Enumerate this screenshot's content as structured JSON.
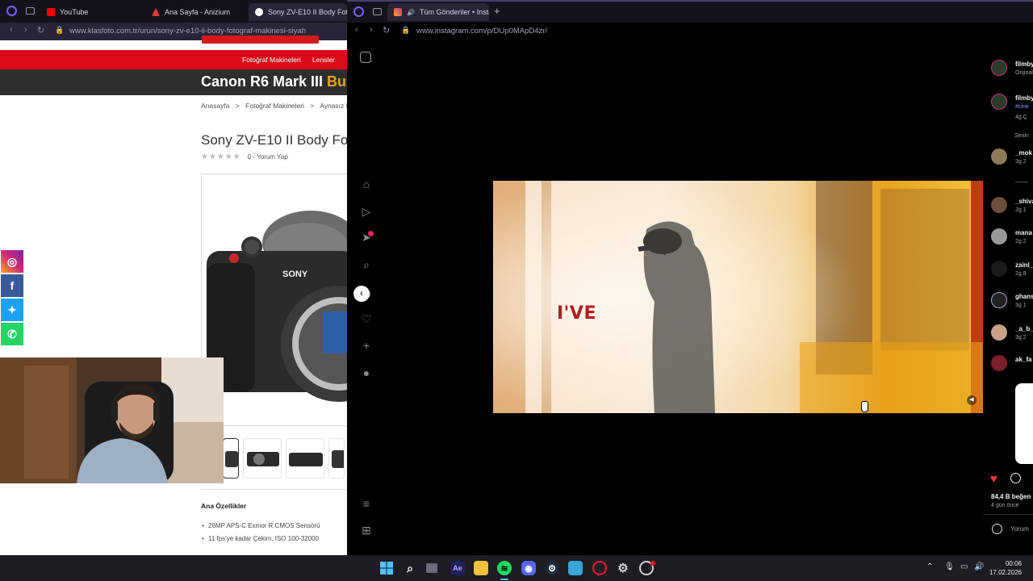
{
  "left_browser": {
    "tabs": [
      {
        "label": "YouTube",
        "favicon_color": "#ff0000"
      },
      {
        "label": "Ana Sayfa - Anizium",
        "favicon_color": "#e53935"
      },
      {
        "label": "Sony ZV-E10 II Body Fotoğ",
        "favicon_color": "#ffffff"
      }
    ],
    "url": "www.klasfoto.com.tr/urun/sony-zv-e10-ii-body-fotograf-makinesi-siyah"
  },
  "site": {
    "nav": [
      "Fotoğraf Makineleri",
      "Lensler"
    ],
    "banner_main": "Canon R6 Mark III",
    "banner_accent": "Bu",
    "breadcrumb": [
      "Anasayfa",
      ">",
      "Fotoğraf Makineleri",
      ">",
      "Aynasız Fo"
    ],
    "product_title": "Sony ZV-E10 II Body Fo",
    "rating_text": "0 - Yorum Yap",
    "rating_stars": "★★★★★",
    "camera_brand": "SONY",
    "features_title": "Ana Özellikler",
    "features": [
      "26MP APS-C Exmor R CMOS Sensörü",
      "11 fps'ye kadar Çekim, ISO 100-32000"
    ],
    "social": [
      {
        "name": "instagram",
        "glyph": "◎",
        "color": "#d62976"
      },
      {
        "name": "facebook",
        "glyph": "f",
        "color": "#3b5998"
      },
      {
        "name": "twitter",
        "glyph": "✦",
        "color": "#1da1f2"
      },
      {
        "name": "whatsapp",
        "glyph": "✆",
        "color": "#25d366"
      }
    ]
  },
  "right_browser": {
    "tab_label": "Tüm Gönderiler • Insta",
    "url": "www.instagram.com/p/DUp0MApD4zr/",
    "add_tab": "+"
  },
  "instagram": {
    "video_caption": "I'VE",
    "comments": [
      {
        "name": "filmby",
        "meta": "Orijinal",
        "color": "#4caf50"
      },
      {
        "name": "filmby",
        "meta": "#cine",
        "color": "#4caf50"
      },
      {
        "name": "",
        "meta": "4g  Ç",
        "color": ""
      },
      {
        "name": "Senin",
        "meta": "",
        "color": ""
      },
      {
        "name": "_mok",
        "meta": "3g  2",
        "color": "#8d7a5a"
      },
      {
        "name": "_shiva",
        "meta": "2g  1",
        "color": "#6b4e3a"
      },
      {
        "name": "mana",
        "meta": "2g  2",
        "color": "#999999"
      },
      {
        "name": "zainl_",
        "meta": "2g  8",
        "color": "#222222"
      },
      {
        "name": "ghans",
        "meta": "3g  1",
        "color": "#b8a0d8"
      },
      {
        "name": "_a_b_",
        "meta": "3g  2",
        "color": "#c9a08a"
      },
      {
        "name": "ak_fa",
        "meta": "",
        "color": "#7a1f2b"
      }
    ],
    "likes": "84,4 B beğen",
    "time_ago": "4 gün önce",
    "comment_placeholder": "Yorum"
  },
  "taskbar": {
    "time": "00:06",
    "date": "17.02.2026"
  }
}
